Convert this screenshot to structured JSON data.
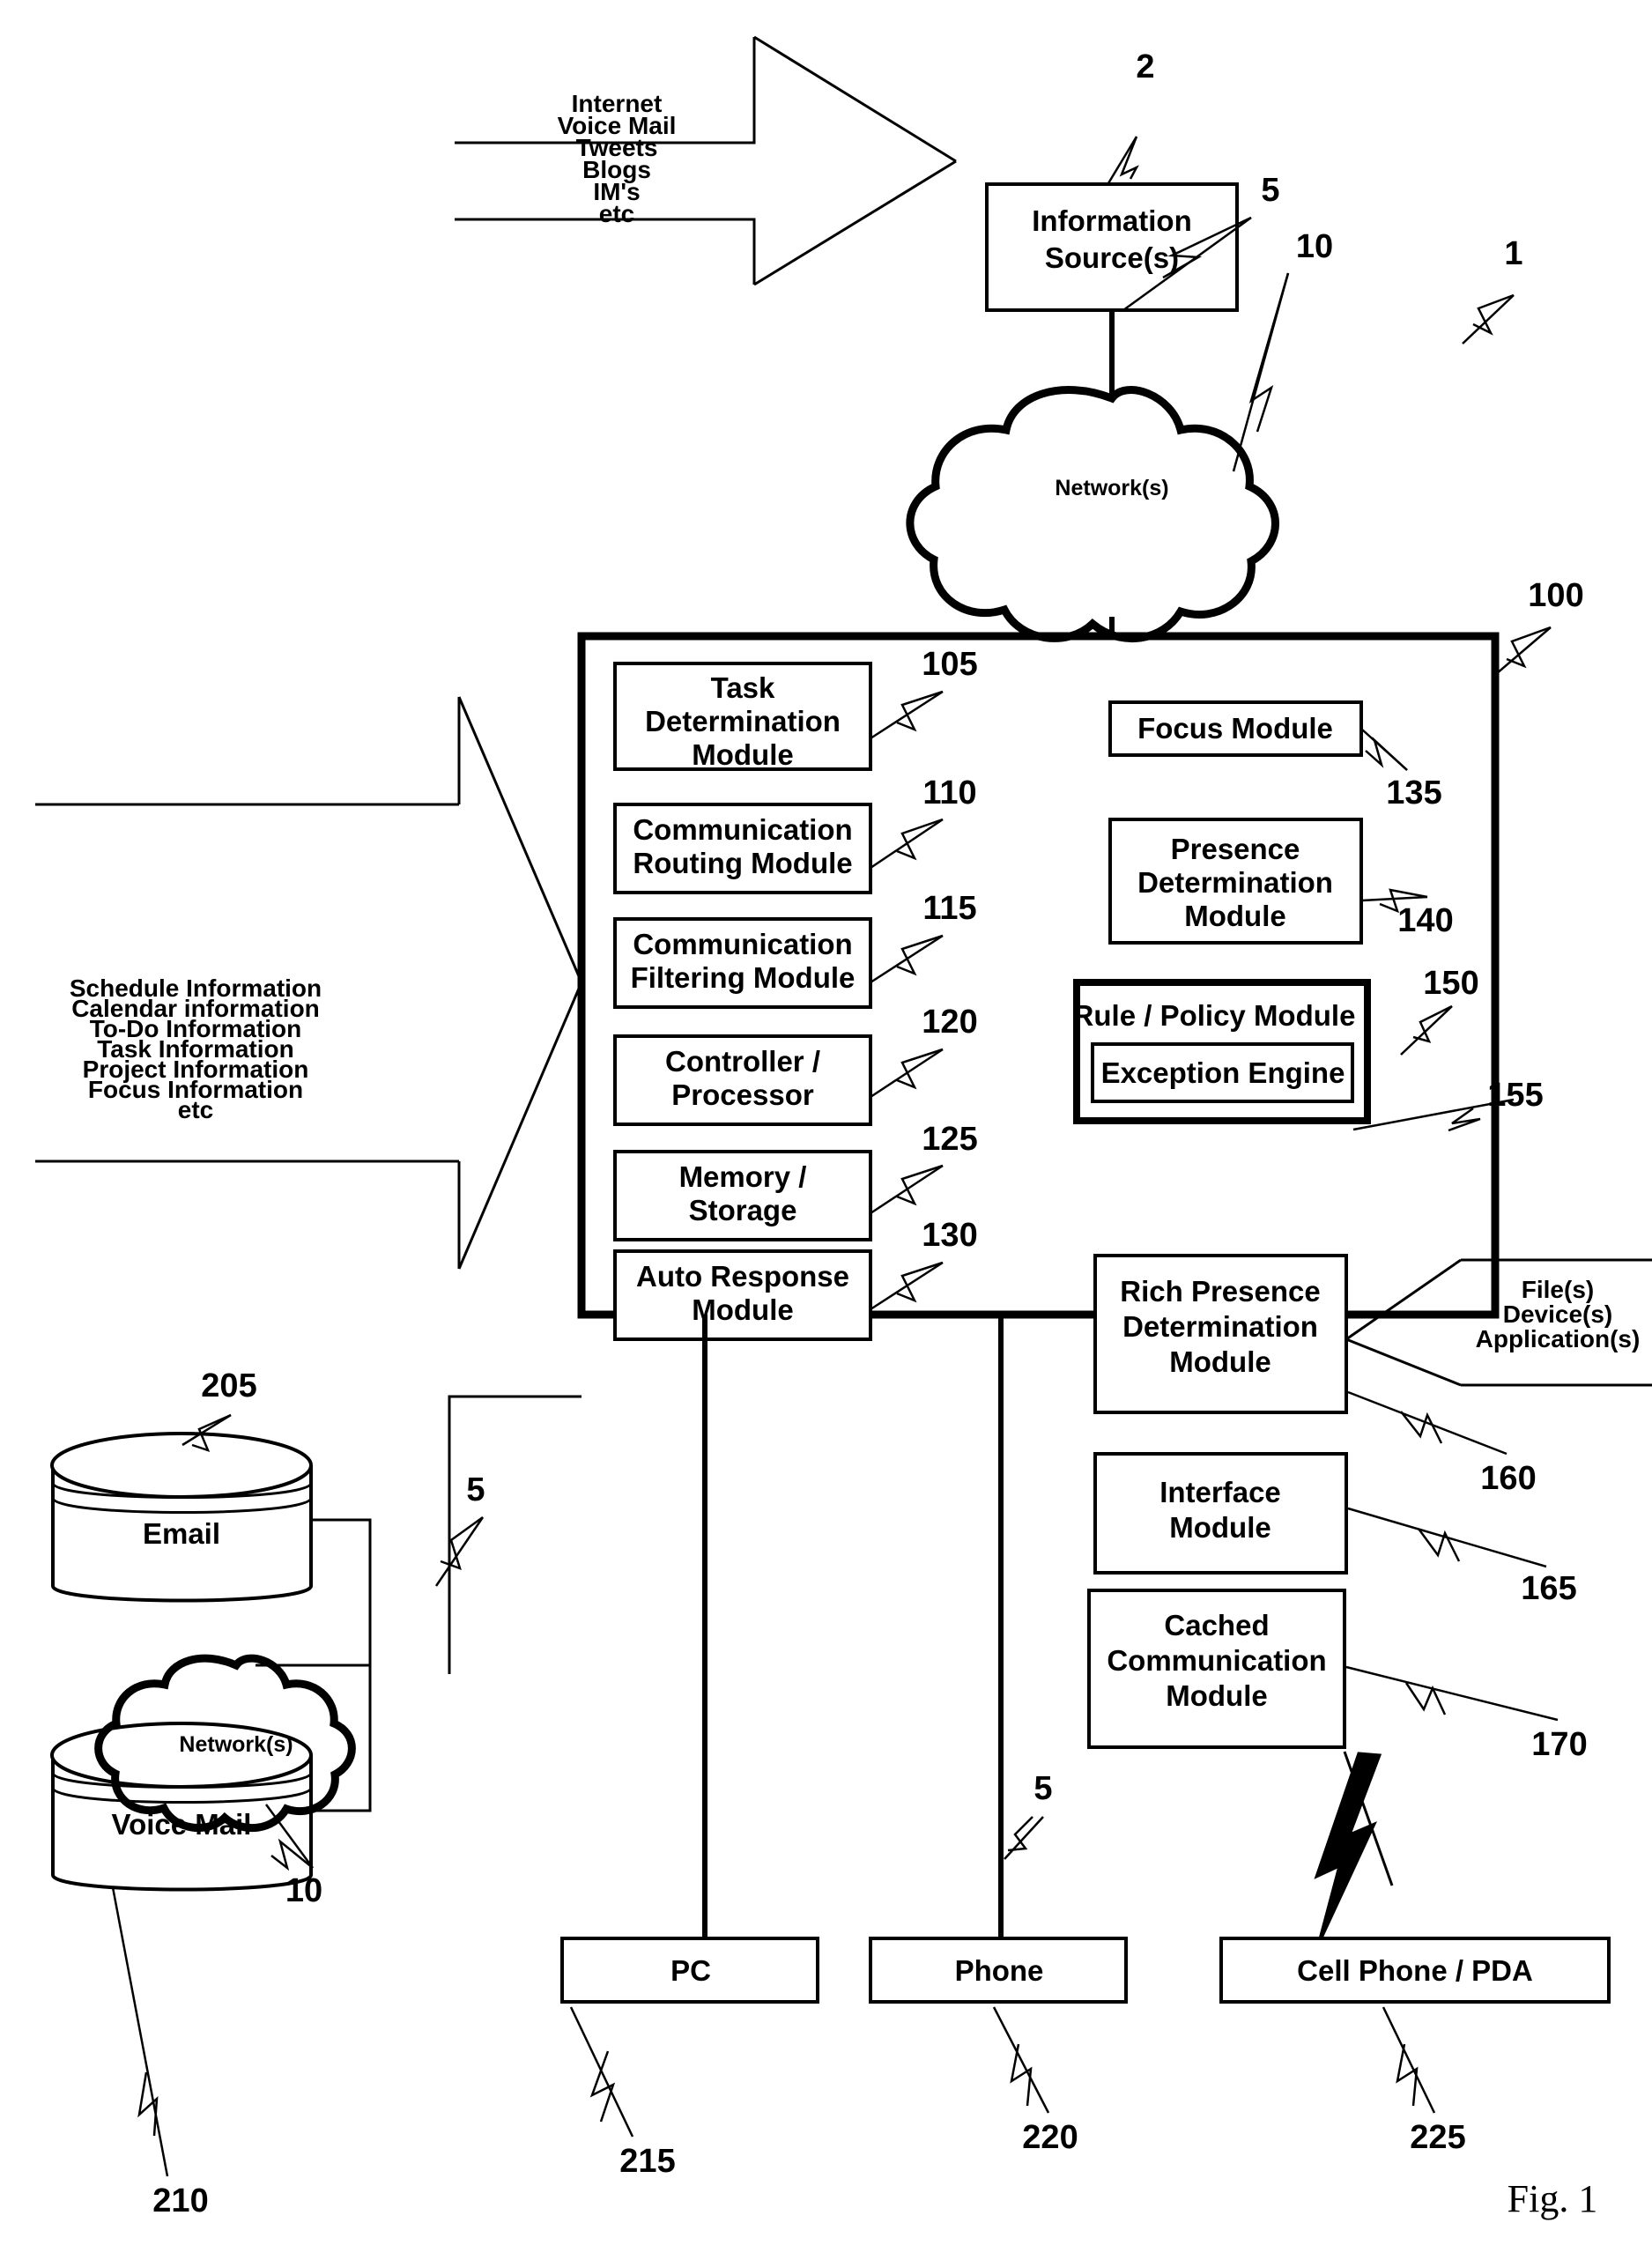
{
  "figure": {
    "caption": "Fig. 1",
    "overall_ref": "1"
  },
  "top_sources": {
    "bracket_items": [
      "Internet",
      "Voice Mail",
      "Tweets",
      "Blogs",
      "IM's",
      "etc"
    ],
    "information_source": {
      "line1": "Information",
      "line2": "Source(s)",
      "ref": "2"
    },
    "link_ref": "5",
    "network": {
      "label": "Network(s)",
      "ref": "10"
    }
  },
  "left_inputs": {
    "bracket_items": [
      "Schedule Information",
      "Calendar information",
      "To-Do Information",
      "Task Information",
      "Project Information",
      "Focus Information",
      "etc"
    ]
  },
  "system": {
    "ref": "100",
    "left_modules": [
      {
        "lines": [
          "Task",
          "Determination",
          "Module"
        ],
        "ref": "105"
      },
      {
        "lines": [
          "Communication",
          "Routing Module"
        ],
        "ref": "110"
      },
      {
        "lines": [
          "Communication",
          "Filtering Module"
        ],
        "ref": "115"
      },
      {
        "lines": [
          "Controller /",
          "Processor"
        ],
        "ref": "120"
      },
      {
        "lines": [
          "Memory /",
          "Storage"
        ],
        "ref": "125"
      },
      {
        "lines": [
          "Auto Response",
          "Module"
        ],
        "ref": "130"
      }
    ],
    "right_modules": [
      {
        "lines": [
          "Focus Module"
        ],
        "ref": "135"
      },
      {
        "lines": [
          "Presence",
          "Determination",
          "Module"
        ],
        "ref": "140"
      },
      {
        "lines": [
          "Rich Presence",
          "Determination",
          "Module"
        ],
        "ref": "160"
      },
      {
        "lines": [
          "Interface",
          "Module"
        ],
        "ref": "165"
      },
      {
        "lines": [
          "Cached",
          "Communication",
          "Module"
        ],
        "ref": "170"
      }
    ],
    "rule_policy": {
      "title": "Rule / Policy Module",
      "ref": "150",
      "child": {
        "title": "Exception Engine",
        "ref": "155"
      }
    }
  },
  "right_inputs": {
    "bracket_items": [
      "File(s)",
      "Device(s)",
      "Application(s)"
    ]
  },
  "storage": {
    "email": {
      "label": "Email",
      "ref": "205"
    },
    "voicemail": {
      "label": "Voice Mail",
      "ref": "210"
    },
    "network": {
      "label": "Network(s)",
      "ref": "10"
    },
    "link_ref": "5"
  },
  "endpoints": [
    {
      "label": "PC",
      "ref": "215",
      "link_ref": ""
    },
    {
      "label": "Phone",
      "ref": "220",
      "link_ref": "5"
    },
    {
      "label": "Cell Phone / PDA",
      "ref": "225",
      "link_ref": ""
    }
  ]
}
